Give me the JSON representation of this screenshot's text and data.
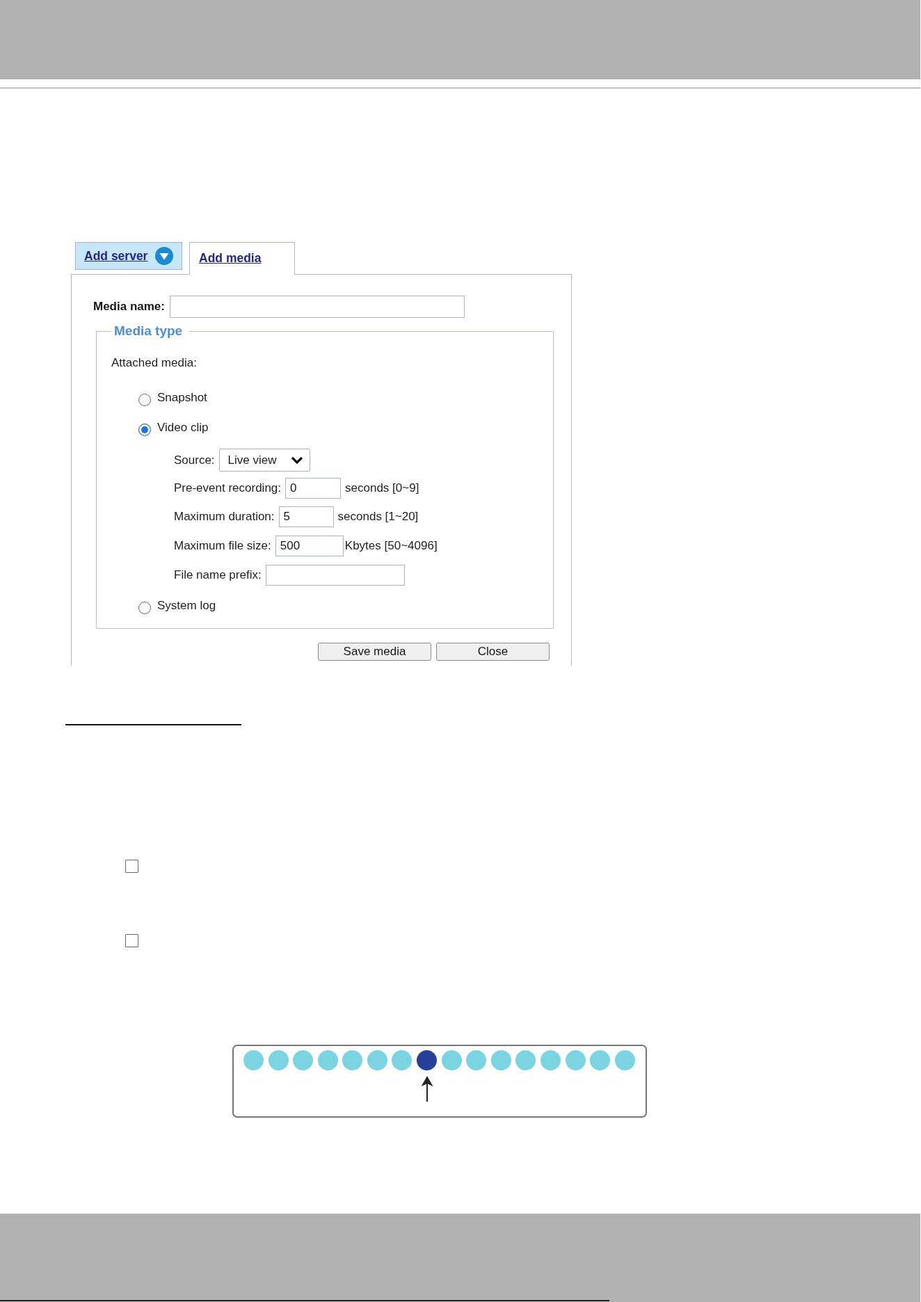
{
  "dialog": {
    "tabs": [
      {
        "label": "Add server",
        "selected": false,
        "has_menu": true
      },
      {
        "label": "Add media",
        "selected": true,
        "has_menu": false
      }
    ],
    "media_name": {
      "label": "Media name:"
    },
    "media_type": {
      "legend": "Media type",
      "intro": "Attached media:",
      "options": [
        {
          "label": "Snapshot",
          "selected": false
        },
        {
          "label": "Video clip",
          "selected": true,
          "fields": [
            {
              "kind": "select",
              "label": "Source:",
              "value": "Live view"
            },
            {
              "kind": "input",
              "label": "Pre-event recording:",
              "value": "0",
              "unit": "seconds [0~9]"
            },
            {
              "kind": "input",
              "label": "Maximum duration:",
              "value": "5",
              "unit": "seconds [1~20]"
            },
            {
              "kind": "input",
              "label": "Maximum file size:",
              "value": "500",
              "unit": "Kbytes [50~4096]"
            },
            {
              "kind": "input",
              "label": "File name prefix:"
            }
          ]
        },
        {
          "label": "System log",
          "selected": false
        }
      ]
    },
    "buttons": [
      {
        "label": "Save media"
      },
      {
        "label": "Close"
      }
    ]
  },
  "checkboxes": [
    {
      "checked": false
    },
    {
      "checked": false
    }
  ],
  "diagram": {
    "dots": [
      {
        "color": "#7ad4e2",
        "marked": false
      },
      {
        "color": "#7ad4e2",
        "marked": false
      },
      {
        "color": "#7ad4e2",
        "marked": false
      },
      {
        "color": "#7ad4e2",
        "marked": false
      },
      {
        "color": "#7ad4e2",
        "marked": false
      },
      {
        "color": "#7ad4e2",
        "marked": false
      },
      {
        "color": "#7ad4e2",
        "marked": false
      },
      {
        "color": "#283f9b",
        "marked": true
      },
      {
        "color": "#7ad4e2",
        "marked": false
      },
      {
        "color": "#7ad4e2",
        "marked": false
      },
      {
        "color": "#7ad4e2",
        "marked": false
      },
      {
        "color": "#7ad4e2",
        "marked": false
      },
      {
        "color": "#7ad4e2",
        "marked": false
      },
      {
        "color": "#7ad4e2",
        "marked": false
      },
      {
        "color": "#7ad4e2",
        "marked": false
      },
      {
        "color": "#7ad4e2",
        "marked": false
      }
    ]
  }
}
